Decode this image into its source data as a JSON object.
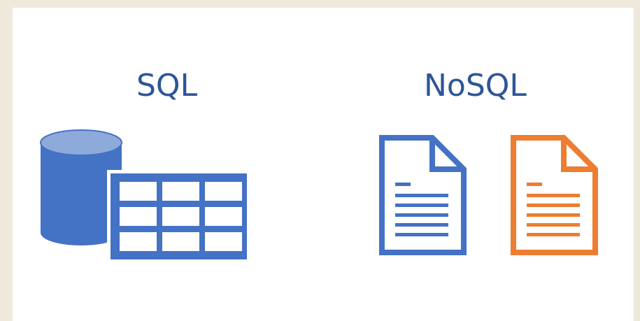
{
  "headings": {
    "sql": "SQL",
    "nosql": "NoSQL"
  },
  "icons": {
    "sql": [
      "database-cylinder-icon",
      "table-grid-icon"
    ],
    "nosql": [
      "document-icon",
      "document-icon"
    ]
  },
  "colors": {
    "background": "#efe9dc",
    "panel": "#ffffff",
    "heading": "#2e5597",
    "blue": "#4472c4",
    "blue_light": "#8eaadb",
    "orange": "#ed7d31"
  }
}
